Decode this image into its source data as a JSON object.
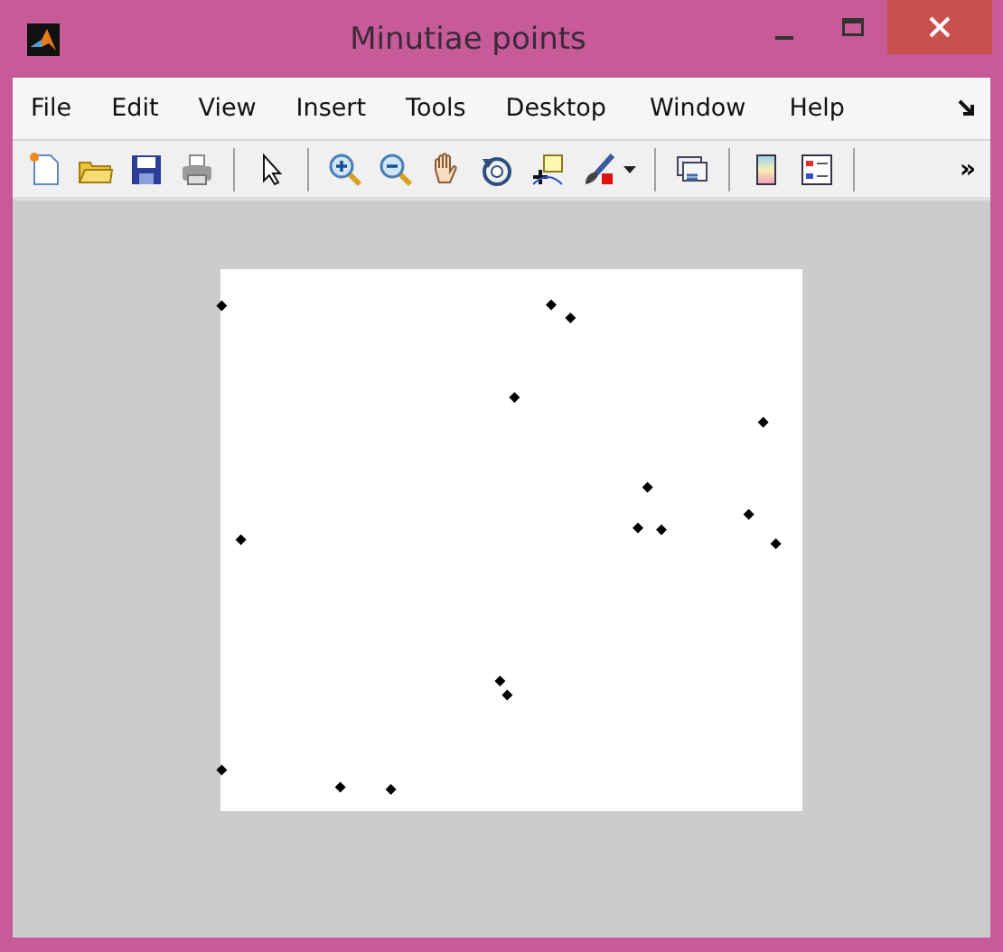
{
  "window": {
    "title": "Minutiae points"
  },
  "menu": [
    {
      "label": "File"
    },
    {
      "label": "Edit"
    },
    {
      "label": "View"
    },
    {
      "label": "Insert"
    },
    {
      "label": "Tools"
    },
    {
      "label": "Desktop"
    },
    {
      "label": "Window"
    },
    {
      "label": "Help"
    }
  ],
  "toolbar": {
    "overflow": "»"
  }
}
